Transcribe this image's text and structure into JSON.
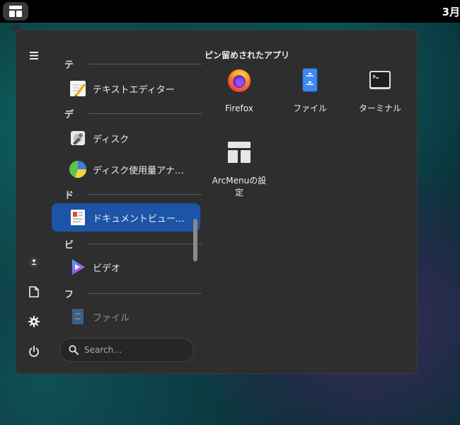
{
  "topbar": {
    "clock": "3月"
  },
  "app_list": {
    "sections": [
      {
        "header": "テ",
        "items": [
          {
            "label": "テキストエディター",
            "icon": "text-editor-icon"
          }
        ]
      },
      {
        "header": "デ",
        "items": [
          {
            "label": "ディスク",
            "icon": "disks-icon"
          },
          {
            "label": "ディスク使用量アナラ…",
            "icon": "disk-usage-analyzer-icon"
          }
        ]
      },
      {
        "header": "ド",
        "items": [
          {
            "label": "ドキュメントビューアー",
            "icon": "document-viewer-icon"
          }
        ]
      },
      {
        "header": "ビ",
        "items": [
          {
            "label": "ビデオ",
            "icon": "videos-icon"
          }
        ]
      },
      {
        "header": "フ",
        "items": [
          {
            "label": "ファイル",
            "icon": "files-icon"
          }
        ]
      }
    ],
    "selected": "ドキュメントビューアー"
  },
  "search": {
    "placeholder": "Search…"
  },
  "pinned": {
    "title": "ピン留めされたアプリ",
    "apps": [
      {
        "label": "Firefox",
        "icon": "firefox-icon"
      },
      {
        "label": "ファイル",
        "icon": "files-icon"
      },
      {
        "label": "ターミナル",
        "icon": "terminal-icon"
      },
      {
        "label": "ArcMenuの設定",
        "icon": "arcmenu-settings-icon"
      }
    ]
  },
  "colors": {
    "selection": "#1c55a8",
    "menu_bg": "#2e2e2e",
    "topbar_bg": "#000000"
  }
}
